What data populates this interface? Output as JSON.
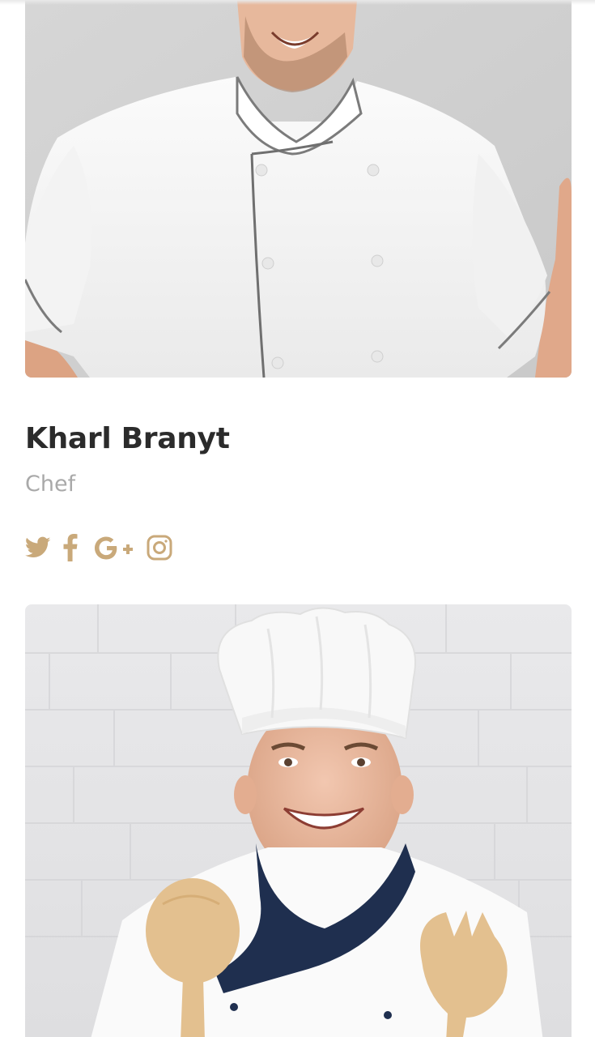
{
  "team_member": {
    "name": "Kharl Branyt",
    "role": "Chef"
  },
  "social_icons": [
    "twitter-icon",
    "facebook-icon",
    "google-plus-icon",
    "instagram-icon"
  ],
  "colors": {
    "accent": "#c9a97a",
    "name_text": "#2b2b2b",
    "role_text": "#a9a9a9",
    "background": "#ffffff"
  }
}
